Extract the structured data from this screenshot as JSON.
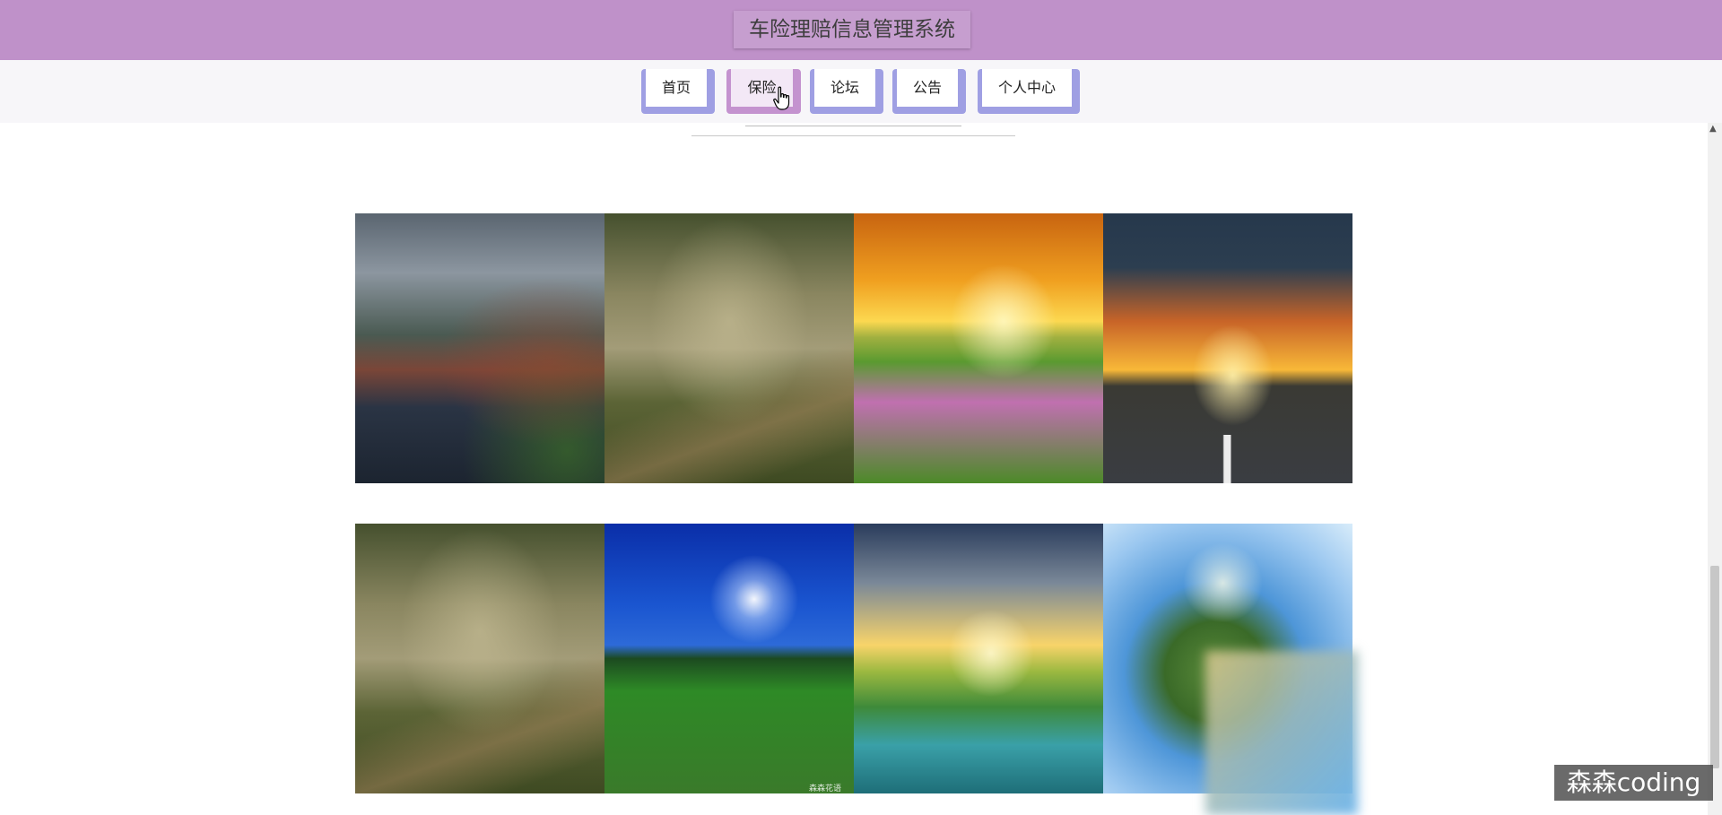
{
  "header": {
    "title": "车险理赔信息管理系统"
  },
  "nav": {
    "items": [
      {
        "label": "首页"
      },
      {
        "label": "保险"
      },
      {
        "label": "论坛"
      },
      {
        "label": "公告"
      },
      {
        "label": "个人中心"
      }
    ]
  },
  "gallery": {
    "rows": [
      {
        "images": [
          "lakeside-village",
          "misty-forest-path",
          "sunset-flower-field",
          "sunset-road"
        ]
      },
      {
        "images": [
          "misty-forest-path",
          "moonlit-meadow",
          "sunlit-lake-valley",
          "tiny-planet-tree"
        ]
      }
    ],
    "caption": "森森花语"
  },
  "watermark": {
    "label": "森森coding"
  },
  "colors": {
    "header_bg": "#bf91c9",
    "nav_button": "#9f9fe3",
    "nav_active": "#c493cf"
  }
}
